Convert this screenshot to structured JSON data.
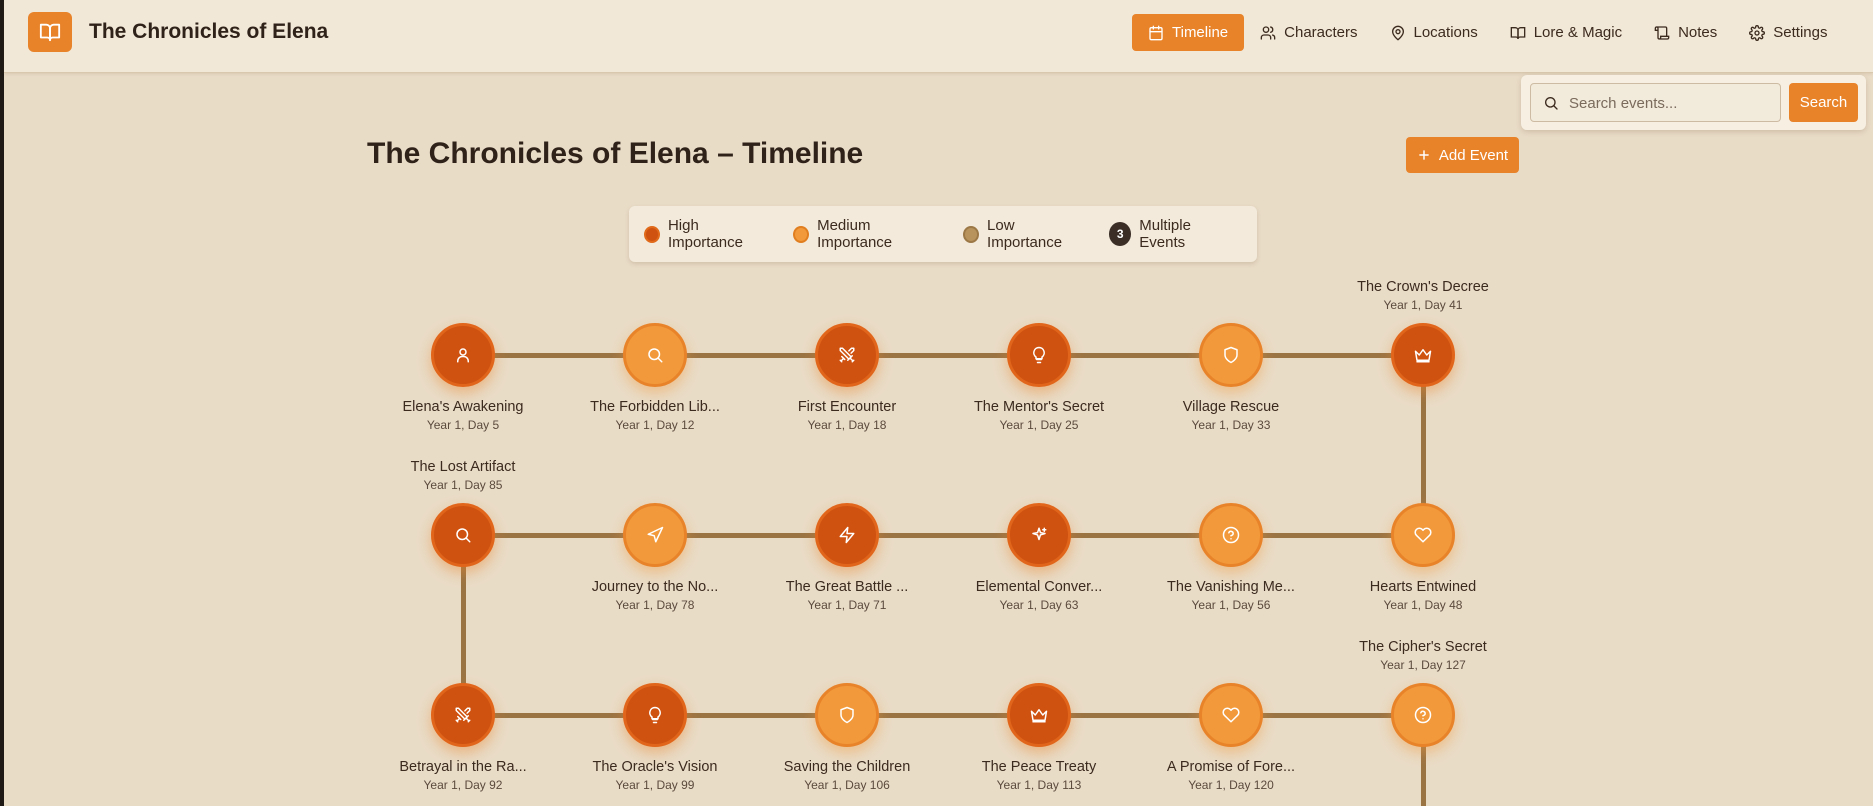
{
  "header": {
    "title": "The Chronicles of Elena",
    "logo_icon": "book-open-icon",
    "nav": [
      {
        "label": "Timeline",
        "icon": "calendar-icon",
        "active": true
      },
      {
        "label": "Characters",
        "icon": "users-icon",
        "active": false
      },
      {
        "label": "Locations",
        "icon": "map-pin-icon",
        "active": false
      },
      {
        "label": "Lore & Magic",
        "icon": "book-icon",
        "active": false
      },
      {
        "label": "Notes",
        "icon": "scroll-icon",
        "active": false
      },
      {
        "label": "Settings",
        "icon": "gear-icon",
        "active": false
      }
    ]
  },
  "search": {
    "placeholder": "Search events...",
    "value": "",
    "button_label": "Search"
  },
  "main": {
    "title": "The Chronicles of Elena – Timeline",
    "add_button_label": "Add Event"
  },
  "legend": {
    "high": "High Importance",
    "medium": "Medium Importance",
    "low": "Low Importance",
    "multiple_count": "3",
    "multiple": "Multiple Events"
  },
  "colors": {
    "accent": "#e8832a",
    "high": "#cf5210",
    "medium": "#f29a3b",
    "low": "#b8935c",
    "track": "#9b7444",
    "background": "#e9dcc7"
  },
  "events": [
    {
      "title": "Elena's Awakening",
      "date": "Year 1, Day 5",
      "importance": "high",
      "icon": "user"
    },
    {
      "title": "The Forbidden Lib...",
      "date": "Year 1, Day 12",
      "importance": "medium",
      "icon": "search"
    },
    {
      "title": "First Encounter",
      "date": "Year 1, Day 18",
      "importance": "high",
      "icon": "swords"
    },
    {
      "title": "The Mentor's Secret",
      "date": "Year 1, Day 25",
      "importance": "high",
      "icon": "lightbulb"
    },
    {
      "title": "Village Rescue",
      "date": "Year 1, Day 33",
      "importance": "medium",
      "icon": "shield"
    },
    {
      "title": "The Crown's Decree",
      "date": "Year 1, Day 41",
      "importance": "high",
      "icon": "crown"
    },
    {
      "title": "Hearts Entwined",
      "date": "Year 1, Day 48",
      "importance": "medium",
      "icon": "heart"
    },
    {
      "title": "The Vanishing Me...",
      "date": "Year 1, Day 56",
      "importance": "medium",
      "icon": "help"
    },
    {
      "title": "Elemental Conver...",
      "date": "Year 1, Day 63",
      "importance": "high",
      "icon": "sparkles"
    },
    {
      "title": "The Great Battle ...",
      "date": "Year 1, Day 71",
      "importance": "high",
      "icon": "zap"
    },
    {
      "title": "Journey to the No...",
      "date": "Year 1, Day 78",
      "importance": "medium",
      "icon": "navigation"
    },
    {
      "title": "The Lost Artifact",
      "date": "Year 1, Day 85",
      "importance": "high",
      "icon": "search"
    },
    {
      "title": "Betrayal in the Ra...",
      "date": "Year 1, Day 92",
      "importance": "high",
      "icon": "swords"
    },
    {
      "title": "The Oracle's Vision",
      "date": "Year 1, Day 99",
      "importance": "high",
      "icon": "lightbulb"
    },
    {
      "title": "Saving the Children",
      "date": "Year 1, Day 106",
      "importance": "medium",
      "icon": "shield"
    },
    {
      "title": "The Peace Treaty",
      "date": "Year 1, Day 113",
      "importance": "high",
      "icon": "crown"
    },
    {
      "title": "A Promise of Fore...",
      "date": "Year 1, Day 120",
      "importance": "medium",
      "icon": "heart"
    },
    {
      "title": "The Cipher's Secret",
      "date": "Year 1, Day 127",
      "importance": "medium",
      "icon": "help"
    }
  ]
}
